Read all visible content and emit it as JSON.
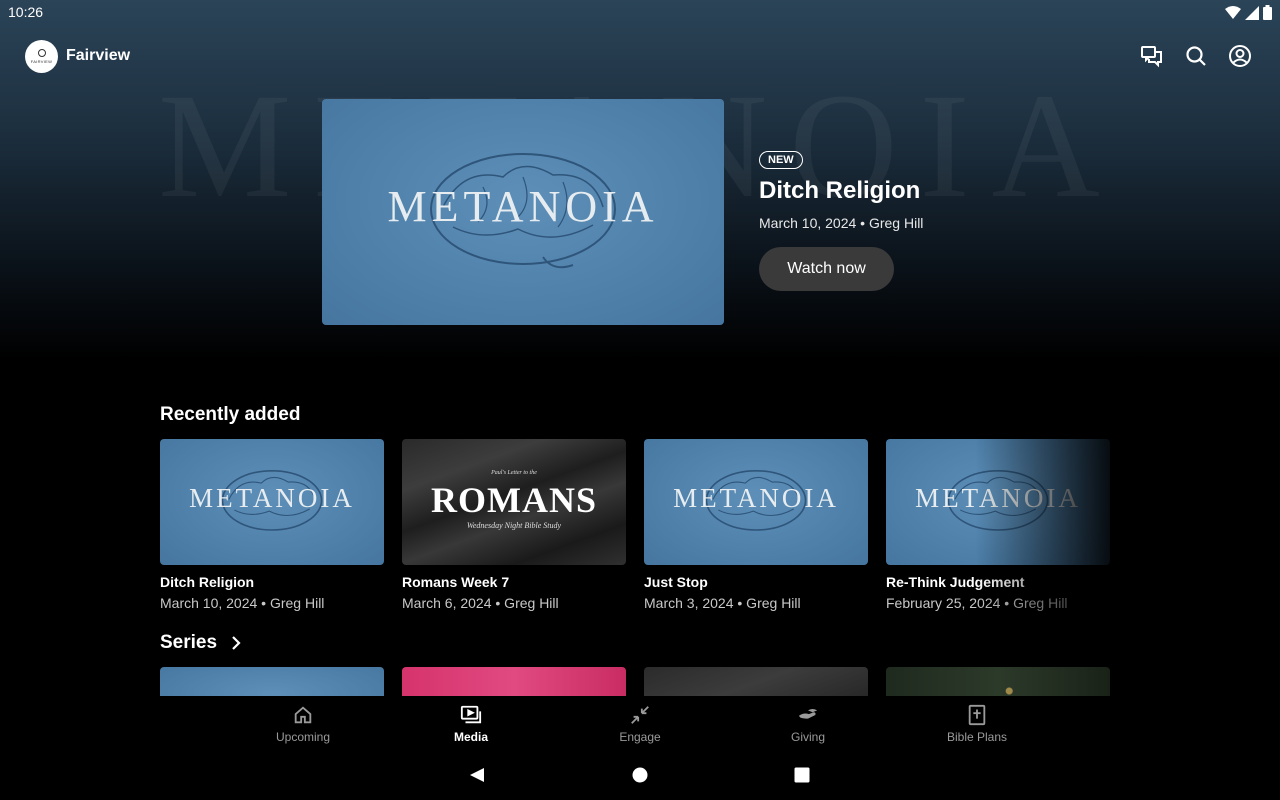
{
  "status_bar": {
    "time": "10:26"
  },
  "app": {
    "name": "Fairview",
    "logo_text": "FAIRVIEW"
  },
  "top_actions": [
    {
      "name": "chat-icon"
    },
    {
      "name": "search-icon"
    },
    {
      "name": "account-icon"
    }
  ],
  "hero": {
    "background_word": "METANOIA",
    "art_word": "METANOIA",
    "badge": "NEW",
    "title": "Ditch Religion",
    "meta": "March 10, 2024 • Greg Hill",
    "button": "Watch now"
  },
  "recent": {
    "title": "Recently added",
    "items": [
      {
        "art": "METANOIA",
        "title": "Ditch Religion",
        "meta": "March 10, 2024 • Greg Hill"
      },
      {
        "art_pre": "Paul's Letter to the",
        "art_big": "ROMANS",
        "art_sub": "Wednesday Night Bible Study",
        "title": "Romans Week 7",
        "meta": "March 6, 2024 • Greg Hill"
      },
      {
        "art": "METANOIA",
        "title": "Just Stop",
        "meta": "March 3, 2024 • Greg Hill"
      },
      {
        "art": "METANOIA",
        "title": "Re-Think Judgement",
        "meta": "February 25, 2024 • Greg Hill"
      }
    ]
  },
  "series": {
    "title": "Series"
  },
  "bottom_nav": [
    {
      "label": "Upcoming",
      "icon": "home-icon",
      "active": false
    },
    {
      "label": "Media",
      "icon": "media-icon",
      "active": true
    },
    {
      "label": "Engage",
      "icon": "engage-icon",
      "active": false
    },
    {
      "label": "Giving",
      "icon": "giving-icon",
      "active": false
    },
    {
      "label": "Bible Plans",
      "icon": "bible-icon",
      "active": false
    }
  ],
  "colors": {
    "accent_blue": "#4e80aa",
    "background": "#000000",
    "button_bg": "#3a3a3a"
  }
}
